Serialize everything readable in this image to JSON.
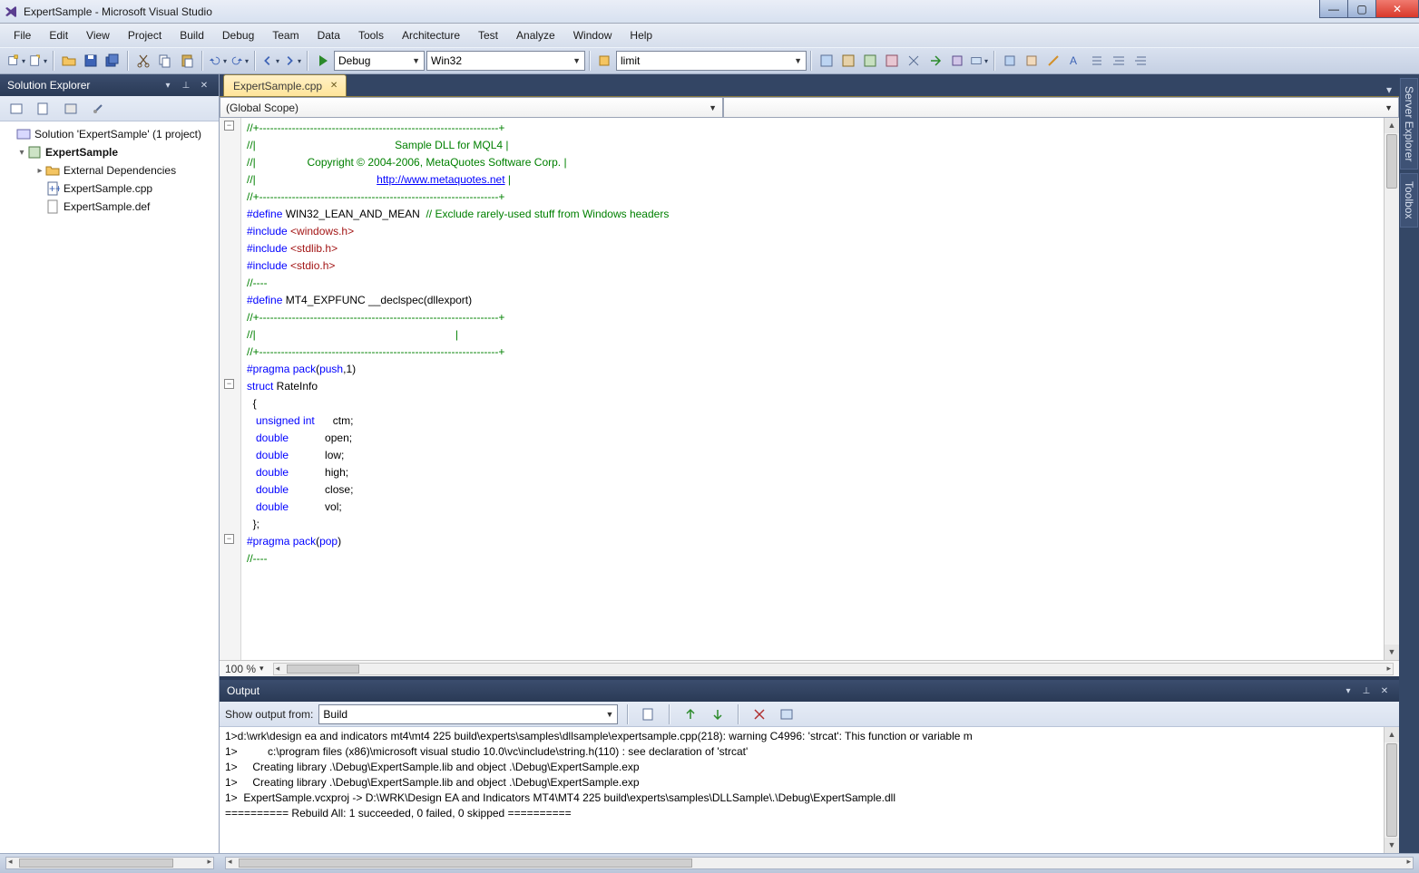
{
  "title": "ExpertSample - Microsoft Visual Studio",
  "menu": [
    "File",
    "Edit",
    "View",
    "Project",
    "Build",
    "Debug",
    "Team",
    "Data",
    "Tools",
    "Architecture",
    "Test",
    "Analyze",
    "Window",
    "Help"
  ],
  "toolbar": {
    "config": "Debug",
    "platform": "Win32",
    "search": "limit"
  },
  "solution_explorer": {
    "title": "Solution Explorer",
    "items": {
      "solution": "Solution 'ExpertSample' (1 project)",
      "project": "ExpertSample",
      "ext_deps": "External Dependencies",
      "file_cpp": "ExpertSample.cpp",
      "file_def": "ExpertSample.def"
    }
  },
  "editor": {
    "tab": "ExpertSample.cpp",
    "scope": "(Global Scope)",
    "zoom": "100 %",
    "code": {
      "l1": "//+------------------------------------------------------------------+",
      "l2a": "//|",
      "l2b": "                                              Sample DLL for MQL4 |",
      "l3a": "//|",
      "l3b": "                 Copyright © 2004-2006, MetaQuotes Software Corp. |",
      "l4a": "//|",
      "l4b": "                                        ",
      "l4c": "http://www.metaquotes.net",
      "l4d": " |",
      "l5": "//+------------------------------------------------------------------+",
      "l6a": "#define",
      "l6b": " WIN32_LEAN_AND_MEAN  ",
      "l6c": "// Exclude rarely-used stuff from Windows headers",
      "l7a": "#include",
      "l7b": " <windows.h>",
      "l8a": "#include",
      "l8b": " <stdlib.h>",
      "l9a": "#include",
      "l9b": " <stdio.h>",
      "l10": "//----",
      "l11a": "#define",
      "l11b": " MT4_EXPFUNC __declspec(dllexport)",
      "l12": "//+------------------------------------------------------------------+",
      "l13": "//|                                                                  |",
      "l14": "//+------------------------------------------------------------------+",
      "l15a": "#pragma",
      "l15b": " ",
      "l15c": "pack",
      "l15d": "(",
      "l15e": "push",
      "l15f": ",1)",
      "l16a": "struct",
      "l16b": " RateInfo",
      "l17": "  {",
      "l18a": "   unsigned",
      "l18b": " int",
      "l18c": "      ctm;",
      "l19a": "   double",
      "l19b": "            open;",
      "l20a": "   double",
      "l20b": "            low;",
      "l21a": "   double",
      "l21b": "            high;",
      "l22a": "   double",
      "l22b": "            close;",
      "l23a": "   double",
      "l23b": "            vol;",
      "l24": "  };",
      "l25a": "#pragma",
      "l25b": " ",
      "l25c": "pack",
      "l25d": "(",
      "l25e": "pop",
      "l25f": ")",
      "l26": "//----"
    }
  },
  "output": {
    "title": "Output",
    "show_from_lbl": "Show output from:",
    "show_from_val": "Build",
    "lines": [
      "1>d:\\wrk\\design ea and indicators mt4\\mt4 225 build\\experts\\samples\\dllsample\\expertsample.cpp(218): warning C4996: 'strcat': This function or variable m",
      "1>          c:\\program files (x86)\\microsoft visual studio 10.0\\vc\\include\\string.h(110) : see declaration of 'strcat'",
      "1>     Creating library .\\Debug\\ExpertSample.lib and object .\\Debug\\ExpertSample.exp",
      "1>     Creating library .\\Debug\\ExpertSample.lib and object .\\Debug\\ExpertSample.exp",
      "1>  ExpertSample.vcxproj -> D:\\WRK\\Design EA and Indicators MT4\\MT4 225 build\\experts\\samples\\DLLSample\\.\\Debug\\ExpertSample.dll",
      "========== Rebuild All: 1 succeeded, 0 failed, 0 skipped =========="
    ]
  },
  "rightdock": [
    "Server Explorer",
    "Toolbox"
  ]
}
